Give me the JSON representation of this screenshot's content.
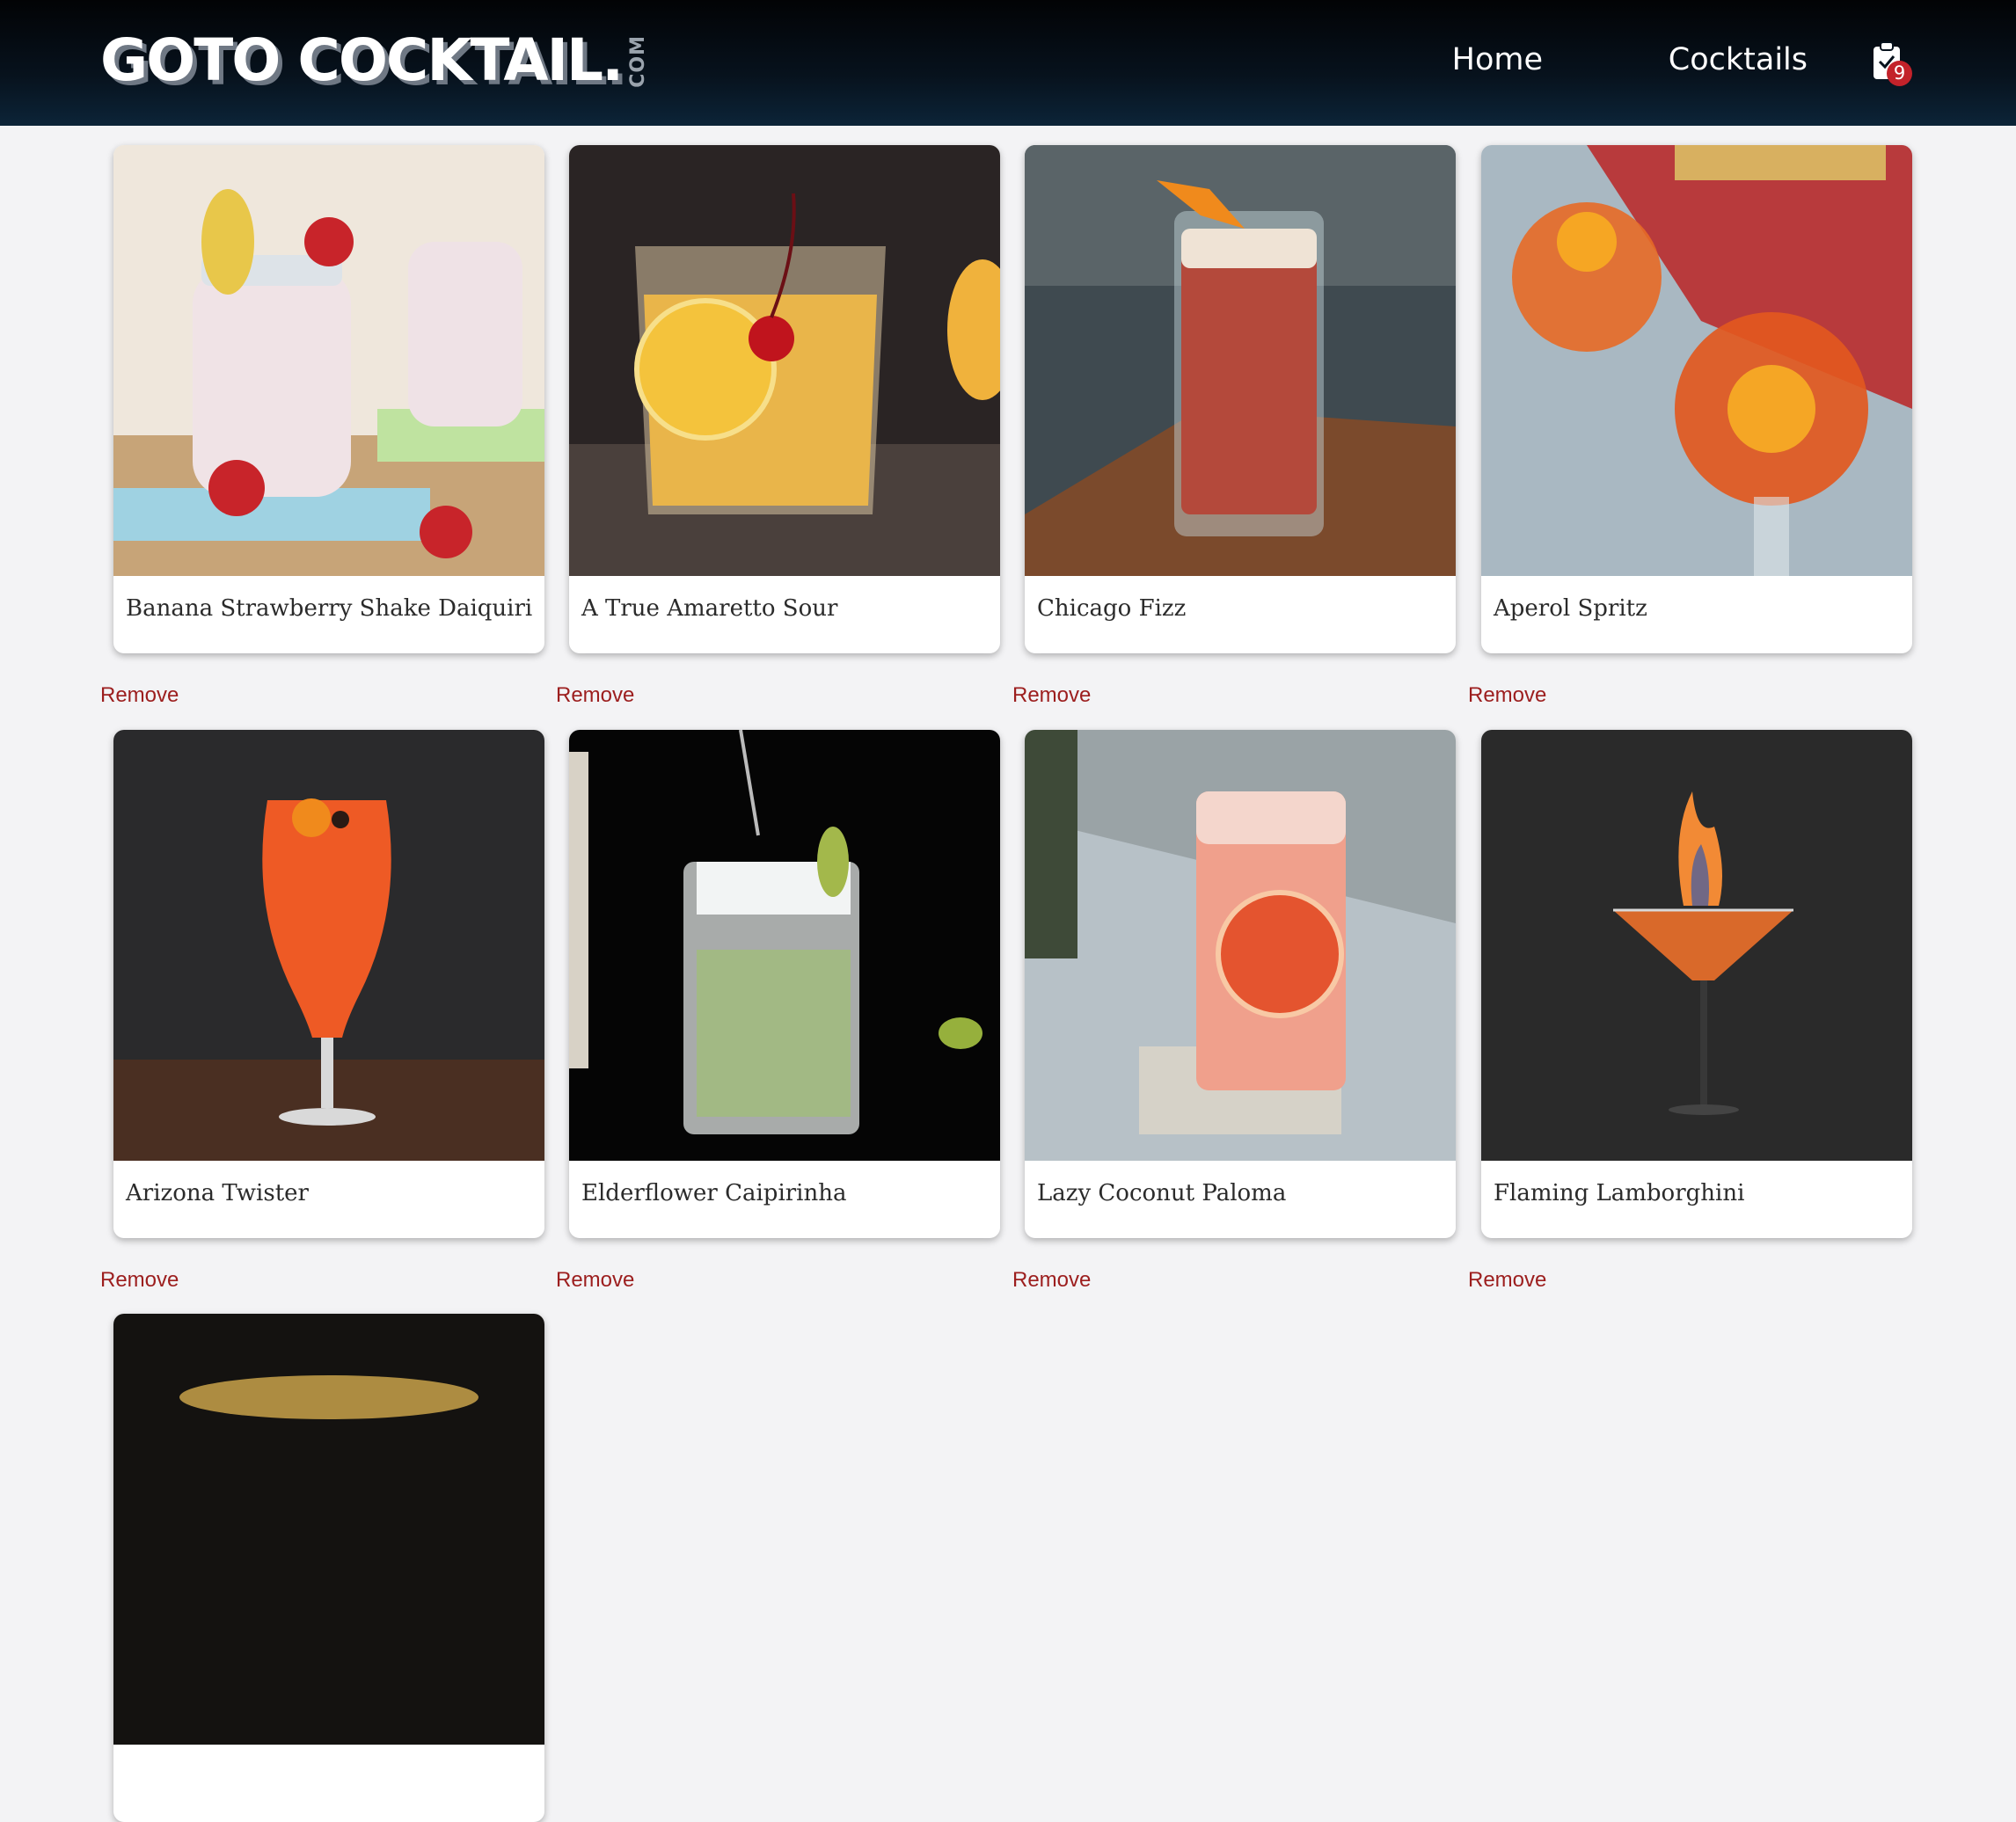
{
  "header": {
    "logo_text": "GOTO COCKTAIL.",
    "logo_suffix": "COM",
    "nav": {
      "home": "Home",
      "cocktails": "Cocktails"
    },
    "cart_count": "9",
    "cart_icon": "clipboard-check-icon"
  },
  "colors": {
    "header_bg": "#05101a",
    "remove": "#9c1e1e",
    "badge": "#c3222a",
    "page_bg": "#f3f3f5"
  },
  "remove_label": "Remove",
  "cocktails": [
    {
      "name": "Banana Strawberry Shake Daiquiri"
    },
    {
      "name": "A True Amaretto Sour"
    },
    {
      "name": "Chicago Fizz"
    },
    {
      "name": "Aperol Spritz"
    },
    {
      "name": "Arizona Twister"
    },
    {
      "name": "Elderflower Caipirinha"
    },
    {
      "name": "Lazy Coconut Paloma"
    },
    {
      "name": "Flaming Lamborghini"
    }
  ]
}
